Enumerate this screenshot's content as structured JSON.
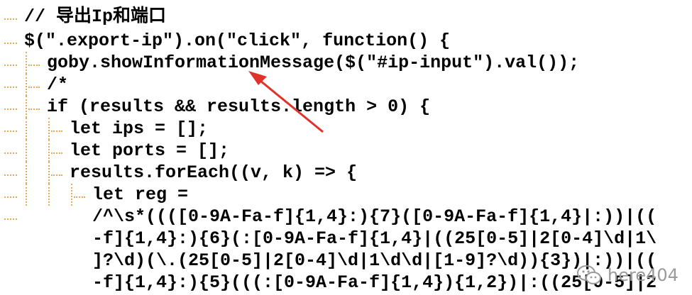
{
  "editor": {
    "lines": [
      {
        "text": "// 导出Ip和端口"
      },
      {
        "text": "$(\".export-ip\").on(\"click\", function() {"
      },
      {
        "text": "goby.showInformationMessage($(\"#ip-input\").val());"
      },
      {
        "text": "/*"
      },
      {
        "text": "if (results && results.length > 0) {"
      },
      {
        "text": "let ips = [];"
      },
      {
        "text": "let ports = [];"
      },
      {
        "text": "results.forEach((v, k) => {"
      },
      {
        "text": "let reg ="
      },
      {
        "text": "/^\\s*((([0-9A-Fa-f]{1,4}:){7}([0-9A-Fa-f]{1,4}|:))|(("
      },
      {
        "text": "-f]{1,4}:){6}(:[0-9A-Fa-f]{1,4}|((25[0-5]|2[0-4]\\d|1\\"
      },
      {
        "text": "]?\\d)(\\.(25[0-5]|2[0-4]\\d|1\\d\\d|[1-9]?\\d)){3})|:))|(("
      },
      {
        "text": "-f]{1,4}:){5}(((:[0-9A-Fa-f]{1,4}){1,2})|:((25[0-5]|2"
      }
    ]
  },
  "annotation": {
    "arrow_color": "#e0312b",
    "points_to": "showInformationMessage"
  },
  "watermark": {
    "text": "here404",
    "icon": "wechat-icon"
  },
  "colors": {
    "background": "#ffffff",
    "code_text": "#000000",
    "indent_guide": "#e6a85a",
    "arrow": "#e0312b",
    "watermark": "#9a9a9a"
  }
}
